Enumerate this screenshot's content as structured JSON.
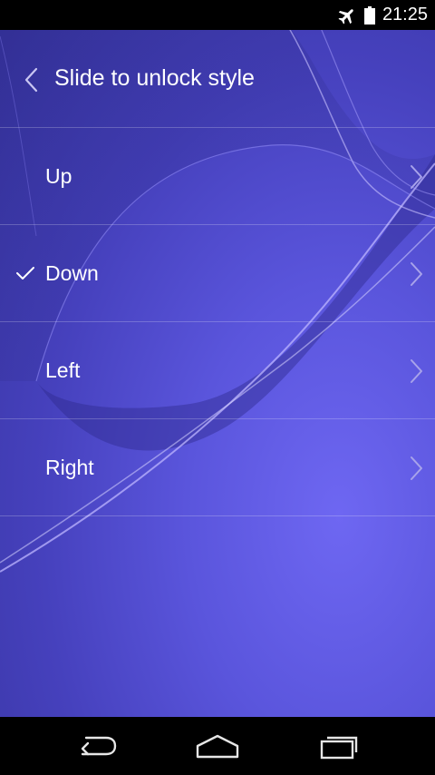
{
  "status_bar": {
    "time": "21:25",
    "icons": [
      "airplane-icon",
      "battery-icon"
    ]
  },
  "header": {
    "title": "Slide to unlock style",
    "back_icon": "chevron-left-icon"
  },
  "options": [
    {
      "label": "Up",
      "selected": false
    },
    {
      "label": "Down",
      "selected": true
    },
    {
      "label": "Left",
      "selected": false
    },
    {
      "label": "Right",
      "selected": false
    }
  ],
  "nav_bar": {
    "icons": [
      "back-icon",
      "home-icon",
      "recents-icon"
    ]
  },
  "colors": {
    "wallpaper_dark": "#35329c",
    "wallpaper_light": "#6e67f2",
    "text": "#ffffff",
    "system_bars": "#000000"
  }
}
